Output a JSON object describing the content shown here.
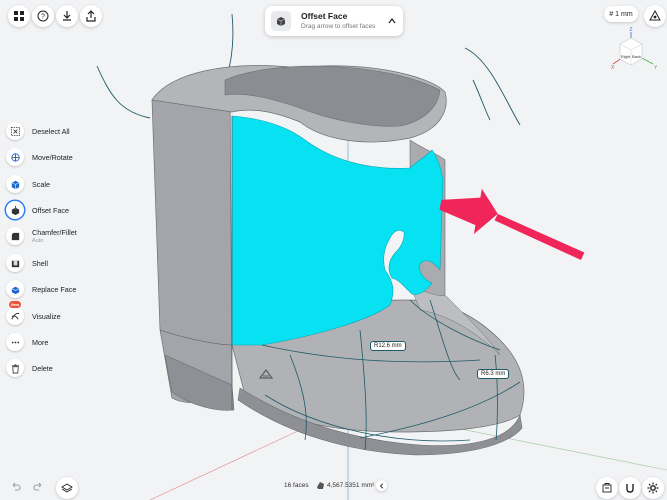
{
  "tool": {
    "title": "Offset Face",
    "subtitle": "Drag arrow to offset faces"
  },
  "units": {
    "label": "# 1 mm"
  },
  "view_cube": {
    "top": "Z",
    "right_face": "Right",
    "back_face": "Back",
    "x_axis": "X",
    "y_axis": "Y"
  },
  "menu": {
    "items": [
      {
        "label": "Deselect All",
        "sub": ""
      },
      {
        "label": "Move/Rotate",
        "sub": ""
      },
      {
        "label": "Scale",
        "sub": ""
      },
      {
        "label": "Offset Face",
        "sub": ""
      },
      {
        "label": "Chamfer/Fillet",
        "sub": "Auto"
      },
      {
        "label": "Shell",
        "sub": ""
      },
      {
        "label": "Replace Face",
        "sub": ""
      },
      {
        "label": "Visualize",
        "sub": "",
        "badge": "New"
      },
      {
        "label": "More",
        "sub": ""
      },
      {
        "label": "Delete",
        "sub": ""
      }
    ]
  },
  "dimensions": {
    "r1": "R12.6 mm",
    "r2": "R6.3 mm"
  },
  "status": {
    "faces": "16 faces",
    "area": "4,567.5351 mm²"
  },
  "colors": {
    "selected_face": "#06e2f2",
    "model": "#a7a9ad",
    "arrow": "#f0265a",
    "accent": "#2f7cf6"
  }
}
